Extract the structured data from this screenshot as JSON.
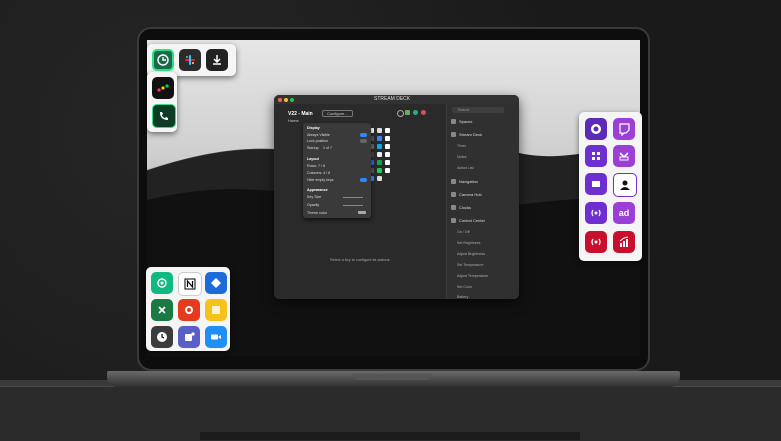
{
  "app": {
    "window_title": "STREAM DECK",
    "profile": "V22 - Main",
    "page": "Home",
    "configure_label": "Configure...",
    "status_text": "Select a key to configure its actions.",
    "search_placeholder": "Search"
  },
  "menu": {
    "sections": [
      {
        "label": "Display",
        "items": [
          "Always Visible",
          "Lock position"
        ]
      },
      {
        "label": "Startup",
        "items": [
          "1 of 7"
        ]
      },
      {
        "label": "Layout",
        "items": [
          "Rows: 7 / 8",
          "Columns: 4 / 8",
          "Hide empty keys"
        ]
      },
      {
        "label": "Appearance",
        "items": [
          "Key Size",
          "Opacity",
          "Theme color"
        ]
      }
    ]
  },
  "sidepane": {
    "categories": [
      {
        "label": "Spaces"
      },
      {
        "label": "Stream Deck",
        "subitems": [
          "Timer",
          "Notes",
          "Action List"
        ]
      },
      {
        "label": "Navigation"
      },
      {
        "label": "Camera Hub"
      },
      {
        "label": "Clocks"
      },
      {
        "label": "Control Center",
        "subitems": [
          "On / Off",
          "Set Brightness",
          "Adjust Brightness",
          "Set Temperature",
          "Adjust Temperature",
          "Set Color",
          "Battery"
        ]
      }
    ]
  },
  "desktop_tiles_left": [
    {
      "name": "stream-deck-icon",
      "color": "#1a6b4a"
    },
    {
      "name": "slack-icon",
      "color": "#2b2b2b"
    },
    {
      "name": "download-icon",
      "color": "#222222"
    },
    {
      "name": "monday-icon",
      "color": "#111111"
    },
    {
      "name": "phone-icon",
      "color": "#0e3b23"
    }
  ],
  "desktop_tiles_bottom": [
    {
      "name": "email-icon",
      "color": "#10b981"
    },
    {
      "name": "notion-icon",
      "color": "#ffffff"
    },
    {
      "name": "jira-icon",
      "color": "#1d6bd6"
    },
    {
      "name": "excel-icon",
      "color": "#1a7a43"
    },
    {
      "name": "office-icon",
      "color": "#e63a1e"
    },
    {
      "name": "sticky-notes-icon",
      "color": "#f4c21b"
    },
    {
      "name": "clock-icon",
      "color": "#3b3b3b"
    },
    {
      "name": "teams-icon",
      "color": "#5a5fc7"
    },
    {
      "name": "zoom-icon",
      "color": "#1f8ef5"
    }
  ],
  "desktop_tiles_right": [
    {
      "name": "obs-icon",
      "color": "#5b2bb5"
    },
    {
      "name": "twitch-icon",
      "color": "#9b3fd6"
    },
    {
      "name": "grid-icon",
      "color": "#6d2fd0"
    },
    {
      "name": "chevron-icon",
      "color": "#9b3fd6"
    },
    {
      "name": "scene-icon",
      "color": "#6d2fd0"
    },
    {
      "name": "user-icon",
      "color": "#6d2fd0"
    },
    {
      "name": "broadcast-icon",
      "color": "#6d2fd0"
    },
    {
      "name": "ad-icon",
      "color": "#9b3fd6"
    },
    {
      "name": "live-icon",
      "color": "#c8102e"
    },
    {
      "name": "stats-icon",
      "color": "#c8102e"
    }
  ],
  "labels": {
    "ad": "ad"
  }
}
